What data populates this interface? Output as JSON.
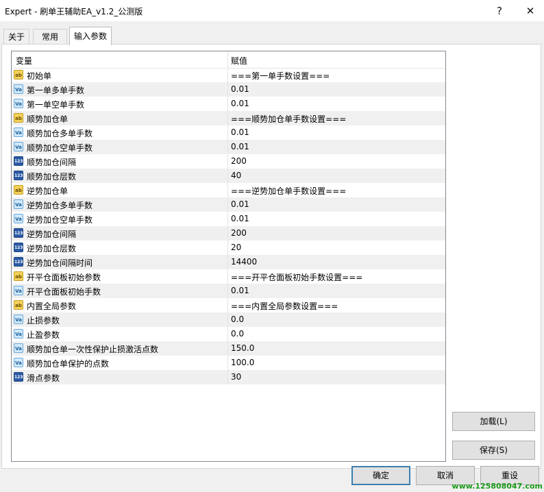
{
  "window": {
    "title": "Expert - 刷单王辅助EA_v1.2_公测版",
    "help": "?",
    "close": "✕"
  },
  "tabs": [
    {
      "label": "关于"
    },
    {
      "label": "常用"
    },
    {
      "label": "输入参数"
    }
  ],
  "grid": {
    "headers": {
      "variable": "变量",
      "value": "赋值"
    },
    "rows": [
      {
        "icon": "ab",
        "name": "初始单",
        "value": "===第一单手数设置==="
      },
      {
        "icon": "va",
        "name": "第一单多单手数",
        "value": "0.01"
      },
      {
        "icon": "va",
        "name": "第一单空单手数",
        "value": "0.01"
      },
      {
        "icon": "ab",
        "name": "顺势加仓单",
        "value": "===顺势加仓单手数设置==="
      },
      {
        "icon": "va",
        "name": "顺势加仓多单手数",
        "value": "0.01"
      },
      {
        "icon": "va",
        "name": "顺势加仓空单手数",
        "value": "0.01"
      },
      {
        "icon": "123",
        "name": "顺势加仓间隔",
        "value": "200"
      },
      {
        "icon": "123",
        "name": "顺势加仓层数",
        "value": "40"
      },
      {
        "icon": "ab",
        "name": "逆势加仓单",
        "value": "===逆势加仓单手数设置==="
      },
      {
        "icon": "va",
        "name": "逆势加仓多单手数",
        "value": "0.01"
      },
      {
        "icon": "va",
        "name": "逆势加仓空单手数",
        "value": "0.01"
      },
      {
        "icon": "123",
        "name": "逆势加仓间隔",
        "value": "200"
      },
      {
        "icon": "123",
        "name": "逆势加仓层数",
        "value": "20"
      },
      {
        "icon": "123",
        "name": "逆势加仓间隔时间",
        "value": "14400"
      },
      {
        "icon": "ab",
        "name": "开平仓面板初始参数",
        "value": "===开平仓面板初始手数设置==="
      },
      {
        "icon": "va",
        "name": "开平仓面板初始手数",
        "value": "0.01"
      },
      {
        "icon": "ab",
        "name": "内置全局参数",
        "value": "===内置全局参数设置==="
      },
      {
        "icon": "va",
        "name": "止损参数",
        "value": "0.0"
      },
      {
        "icon": "va",
        "name": "止盈参数",
        "value": "0.0"
      },
      {
        "icon": "va",
        "name": "顺势加仓单一次性保护止损激活点数",
        "value": "150.0"
      },
      {
        "icon": "va",
        "name": "顺势加仓单保护的点数",
        "value": "100.0"
      },
      {
        "icon": "123",
        "name": "滑点参数",
        "value": "30"
      }
    ]
  },
  "buttons": {
    "load": "加载(L)",
    "save": "保存(S)",
    "ok": "确定",
    "cancel": "取消",
    "reset": "重设"
  },
  "watermark": "www.125808047.com"
}
